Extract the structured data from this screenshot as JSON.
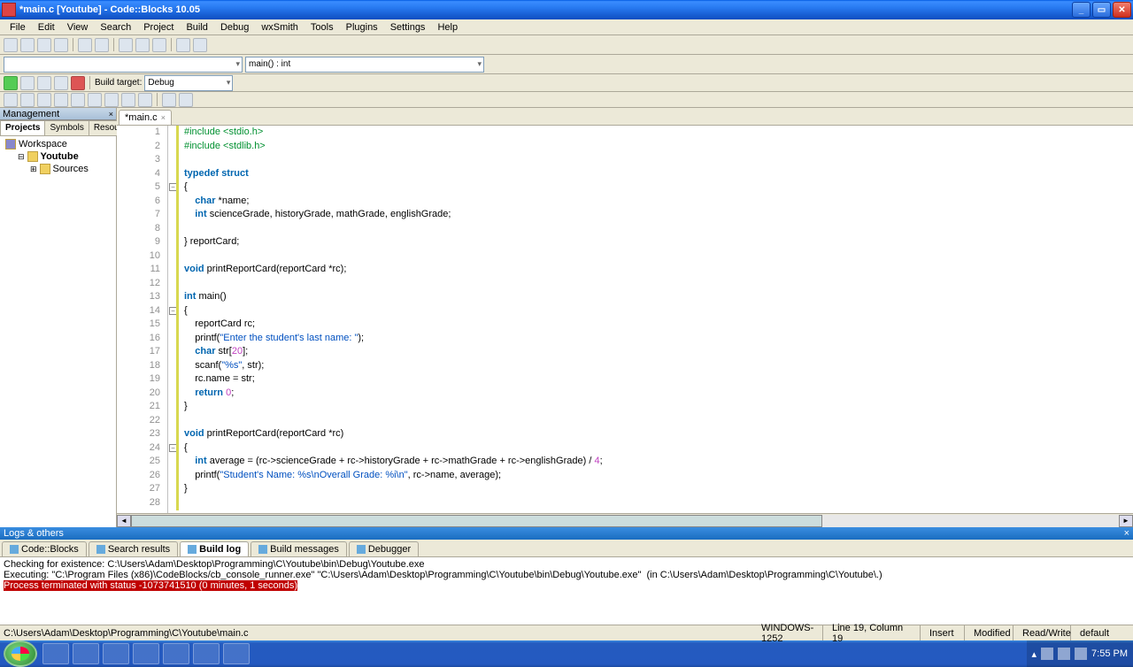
{
  "title": "*main.c [Youtube] - Code::Blocks 10.05",
  "menu": [
    "File",
    "Edit",
    "View",
    "Search",
    "Project",
    "Build",
    "Debug",
    "wxSmith",
    "Tools",
    "Plugins",
    "Settings",
    "Help"
  ],
  "combo1": "",
  "combo2": "main() : int",
  "build_target_label": "Build target:",
  "build_target_value": "Debug",
  "mgmt": {
    "title": "Management",
    "tabs": [
      "Projects",
      "Symbols",
      "Resou"
    ],
    "tree": [
      "Workspace",
      "Youtube",
      "Sources"
    ]
  },
  "file_tab": "*main.c",
  "code": {
    "lines": [
      {
        "n": 1,
        "html": "<span class='pp'>#include &lt;stdio.h&gt;</span>"
      },
      {
        "n": 2,
        "html": "<span class='pp'>#include &lt;stdlib.h&gt;</span>"
      },
      {
        "n": 3,
        "html": ""
      },
      {
        "n": 4,
        "html": "<span class='kw'>typedef</span> <span class='kw'>struct</span>"
      },
      {
        "n": 5,
        "html": "{"
      },
      {
        "n": 6,
        "html": "    <span class='kw'>char</span> *name;"
      },
      {
        "n": 7,
        "html": "    <span class='kw'>int</span> scienceGrade, historyGrade, mathGrade, englishGrade;"
      },
      {
        "n": 8,
        "html": ""
      },
      {
        "n": 9,
        "html": "} reportCard;"
      },
      {
        "n": 10,
        "html": ""
      },
      {
        "n": 11,
        "html": "<span class='kw'>void</span> printReportCard(reportCard *rc);"
      },
      {
        "n": 12,
        "html": ""
      },
      {
        "n": 13,
        "html": "<span class='kw'>int</span> main()"
      },
      {
        "n": 14,
        "html": "{"
      },
      {
        "n": 15,
        "html": "    reportCard rc;"
      },
      {
        "n": 16,
        "html": "    printf(<span class='str'>\"Enter the student's last name: \"</span>);"
      },
      {
        "n": 17,
        "html": "    <span class='kw'>char</span> str[<span class='num'>20</span>];"
      },
      {
        "n": 18,
        "html": "    scanf(<span class='str'>\"%s\"</span>, str);"
      },
      {
        "n": 19,
        "html": "    rc.name = str;"
      },
      {
        "n": 20,
        "html": "    <span class='kw'>return</span> <span class='num'>0</span>;"
      },
      {
        "n": 21,
        "html": "}"
      },
      {
        "n": 22,
        "html": ""
      },
      {
        "n": 23,
        "html": "<span class='kw'>void</span> printReportCard(reportCard *rc)"
      },
      {
        "n": 24,
        "html": "{"
      },
      {
        "n": 25,
        "html": "    <span class='kw'>int</span> average = (rc-&gt;scienceGrade + rc-&gt;historyGrade + rc-&gt;mathGrade + rc-&gt;englishGrade) / <span class='num'>4</span>;"
      },
      {
        "n": 26,
        "html": "    printf(<span class='str'>\"Student's Name: %s\\nOverall Grade: %i\\n\"</span>, rc-&gt;name, average);"
      },
      {
        "n": 27,
        "html": "}"
      },
      {
        "n": 28,
        "html": ""
      }
    ]
  },
  "logs": {
    "title": "Logs & others",
    "tabs": [
      "Code::Blocks",
      "Search results",
      "Build log",
      "Build messages",
      "Debugger"
    ],
    "active_tab": 2,
    "lines": [
      "Checking for existence: C:\\Users\\Adam\\Desktop\\Programming\\C\\Youtube\\bin\\Debug\\Youtube.exe",
      "Executing: \"C:\\Program Files (x86)\\CodeBlocks/cb_console_runner.exe\" \"C:\\Users\\Adam\\Desktop\\Programming\\C\\Youtube\\bin\\Debug\\Youtube.exe\"  (in C:\\Users\\Adam\\Desktop\\Programming\\C\\Youtube\\.)"
    ],
    "error": "Process terminated with status -1073741510 (0 minutes, 1 seconds)"
  },
  "status": {
    "path": "C:\\Users\\Adam\\Desktop\\Programming\\C\\Youtube\\main.c",
    "encoding": "WINDOWS-1252",
    "pos": "Line 19, Column 19",
    "insert": "Insert",
    "modified": "Modified",
    "rw": "Read/Write",
    "extra": "default"
  },
  "tray_time": "7:55 PM"
}
